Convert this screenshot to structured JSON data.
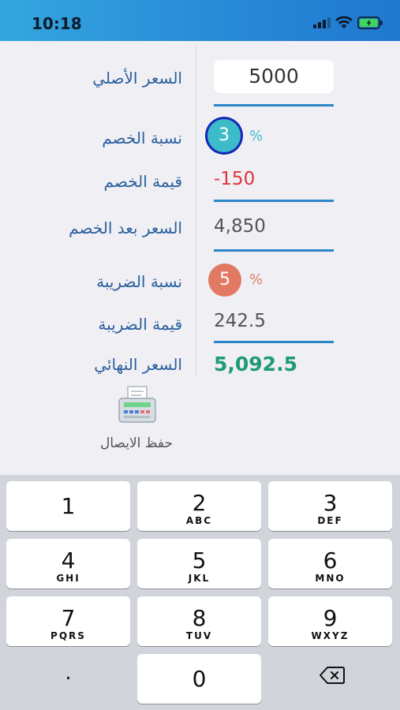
{
  "status_bar": {
    "time": "10:18"
  },
  "form": {
    "original_price": {
      "label": "السعر الأصلي",
      "value": "5000"
    },
    "discount_rate": {
      "label": "نسبة الخصم",
      "value": "3",
      "unit": "%"
    },
    "discount_value": {
      "label": "قيمة الخصم",
      "value": "-150"
    },
    "price_after_discount": {
      "label": "السعر بعد الخصم",
      "value": "4,850"
    },
    "tax_rate": {
      "label": "نسبة الضريبة",
      "value": "5",
      "unit": "%"
    },
    "tax_value": {
      "label": "قيمة الضريبة",
      "value": "242.5"
    },
    "final_price": {
      "label": "السعر النهائي",
      "value": "5,092.5"
    }
  },
  "save_receipt": {
    "label": "حفظ الايصال",
    "icon": "receipt-printer-icon"
  },
  "keypad": {
    "keys": [
      {
        "digit": "1",
        "letters": ""
      },
      {
        "digit": "2",
        "letters": "ABC"
      },
      {
        "digit": "3",
        "letters": "DEF"
      },
      {
        "digit": "4",
        "letters": "GHI"
      },
      {
        "digit": "5",
        "letters": "JKL"
      },
      {
        "digit": "6",
        "letters": "MNO"
      },
      {
        "digit": "7",
        "letters": "PQRS"
      },
      {
        "digit": "8",
        "letters": "TUV"
      },
      {
        "digit": "9",
        "letters": "WXYZ"
      },
      {
        "digit": "0",
        "letters": ""
      }
    ],
    "decimal": ".",
    "delete_icon": "backspace-icon"
  },
  "colors": {
    "label": "#2a5f9e",
    "discount_accent": "#3cbcc8",
    "tax_accent": "#e27a63",
    "negative": "#e0343f",
    "final": "#1f9a74",
    "underline": "#2a86c8"
  }
}
